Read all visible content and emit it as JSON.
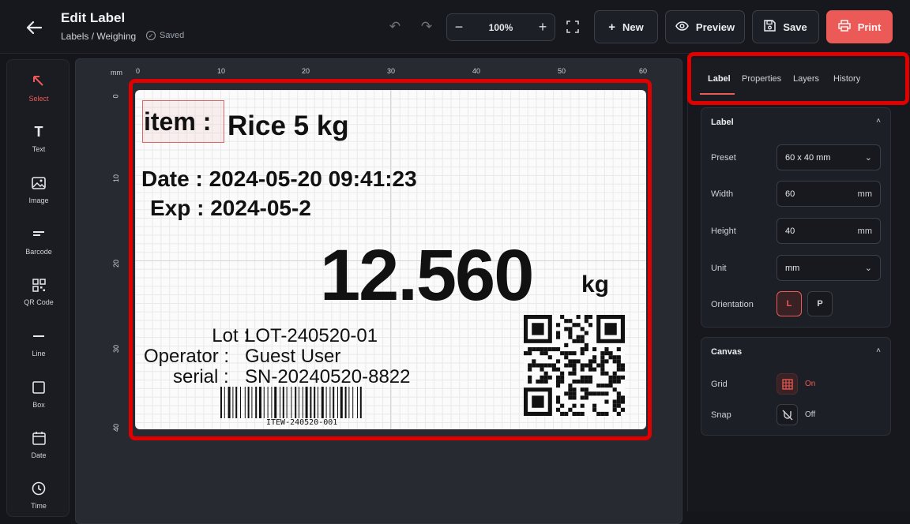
{
  "header": {
    "title": "Edit Label",
    "breadcrumb": "Labels / Weighing",
    "saved_status": "Saved",
    "zoom": "100%",
    "buttons": {
      "new": "New",
      "preview": "Preview",
      "save": "Save",
      "print": "Print"
    }
  },
  "tools": [
    {
      "label": "Select",
      "icon": "cursor-icon"
    },
    {
      "label": "Text",
      "icon": "text-icon"
    },
    {
      "label": "Image",
      "icon": "image-icon"
    },
    {
      "label": "Barcode",
      "icon": "barcode-icon"
    },
    {
      "label": "QR Code",
      "icon": "qr-code-icon"
    },
    {
      "label": "Line",
      "icon": "line-icon"
    },
    {
      "label": "Box",
      "icon": "box-icon"
    },
    {
      "label": "Date",
      "icon": "calendar-icon"
    },
    {
      "label": "Time",
      "icon": "clock-icon"
    }
  ],
  "ruler": {
    "unit": "mm",
    "h": [
      "0",
      "10",
      "20",
      "30",
      "40",
      "50",
      "60"
    ],
    "v": [
      "0",
      "10",
      "20",
      "30",
      "40"
    ]
  },
  "label": {
    "item_prefix": "item :",
    "item_value": "Rice 5 kg",
    "date_line": "Date : 2024-05-20  09:41:23",
    "exp_line": "Exp : 2024-05-2",
    "weight": "12.560",
    "weight_unit": "kg",
    "lot_key": "Lot :",
    "lot_value": "LOT-240520-01",
    "op_key": "Operator  :",
    "op_value": "Guest User",
    "serial_key": "serial  :",
    "serial_value": "SN-20240520-8822",
    "barcode_text": "ITEW-240520-001"
  },
  "panel": {
    "tabs": [
      "Label",
      "Properties",
      "Layers",
      "History"
    ],
    "label_section": {
      "title": "Label",
      "preset_label": "Preset",
      "preset": "60 x 40 mm",
      "width_label": "Width",
      "width": "60",
      "width_unit": "mm",
      "height_label": "Height",
      "height": "40",
      "height_unit": "mm",
      "unit_label": "Unit",
      "unit": "mm",
      "orientation_label": "Orientation",
      "orientation_l": "L",
      "orientation_p": "P"
    },
    "canvas_section": {
      "title": "Canvas",
      "grid_label": "Grid",
      "grid_state": "On",
      "snap_label": "Snap",
      "snap_state": "Off"
    }
  },
  "colors": {
    "accent": "#ec5a57",
    "highlight": "#e10000"
  }
}
